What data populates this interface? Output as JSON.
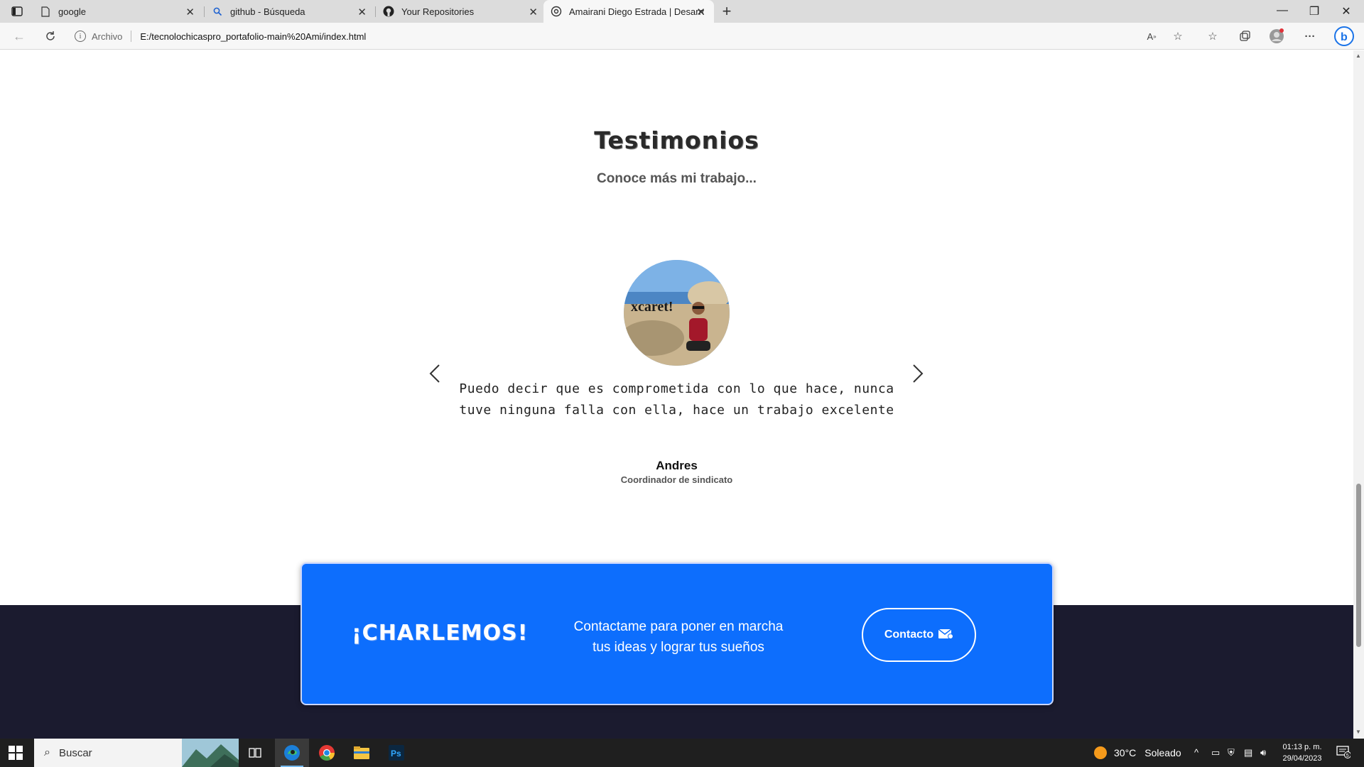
{
  "browser": {
    "tabs": [
      {
        "title": "google",
        "icon": "page-icon",
        "active": false
      },
      {
        "title": "github - Búsqueda",
        "icon": "search-icon",
        "active": false
      },
      {
        "title": "Your Repositories",
        "icon": "github-icon",
        "active": false
      },
      {
        "title": "Amairani Diego Estrada | Desarro",
        "icon": "site-icon",
        "active": true
      }
    ],
    "address": {
      "protocol_label": "Archivo",
      "url": "E:/tecnolochicaspro_portafolio-main%20Ami/index.html"
    }
  },
  "page": {
    "testimonials": {
      "title": "Testimonios",
      "subtitle": "Conoce más mi trabajo...",
      "quote": "Puedo decir que es comprometida con lo que hace, nunca tuve ninguna falla con ella, hace un trabajo excelente",
      "author": "Andres",
      "role": "Coordinador de sindicato",
      "avatar_caption": "xcaret!"
    },
    "cta": {
      "title": "¡CHARLEMOS!",
      "text": "Contactame para poner en marcha tus ideas y lograr tus sueños",
      "button_label": "Contacto"
    }
  },
  "taskbar": {
    "search_placeholder": "Buscar",
    "weather_temp": "30°C",
    "weather_condition": "Soleado",
    "time": "01:13 p. m.",
    "date": "29/04/2023",
    "notification_count": "5"
  },
  "colors": {
    "accent": "#0d6efd",
    "footer": "#1b1b2f"
  }
}
